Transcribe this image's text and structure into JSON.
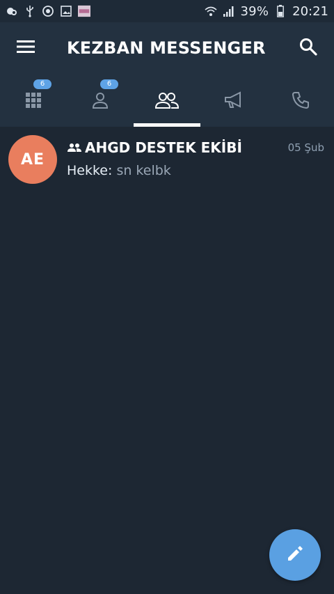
{
  "status_bar": {
    "icons_left": [
      "weather-icon",
      "usb-icon",
      "sync-icon",
      "image-icon",
      "app-thumbnail-icon"
    ],
    "battery_text": "39%",
    "time": "20:21"
  },
  "header": {
    "title": "KEZBAN MESSENGER"
  },
  "tabs": [
    {
      "name": "all",
      "icon": "grid-icon",
      "badge": "6",
      "active": false
    },
    {
      "name": "contacts",
      "icon": "person-icon",
      "badge": "6",
      "active": false
    },
    {
      "name": "groups",
      "icon": "group-icon",
      "badge": "",
      "active": true
    },
    {
      "name": "channels",
      "icon": "megaphone-icon",
      "badge": "",
      "active": false
    },
    {
      "name": "calls",
      "icon": "phone-icon",
      "badge": "",
      "active": false
    }
  ],
  "chats": [
    {
      "avatar_initials": "AE",
      "avatar_color": "#e97e5e",
      "title": "AHGD DESTEK EKİBİ",
      "date": "05 Şub",
      "sender": "Hekke:",
      "message": " sn kelbk"
    }
  ],
  "colors": {
    "background": "#1d2733",
    "bars": "#233140",
    "accent": "#5aa0e2"
  }
}
